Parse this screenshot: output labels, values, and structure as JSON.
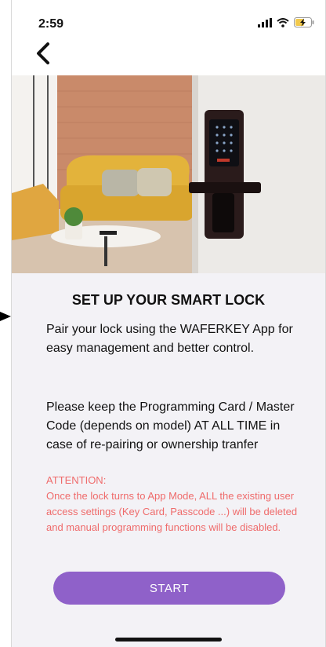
{
  "status": {
    "time": "2:59"
  },
  "content": {
    "title": "SET UP YOUR SMART LOCK",
    "paragraph1": "Pair your lock using the WAFERKEY App for easy management and better control.",
    "paragraph2": "Please keep the Programming Card / Master Code (depends on model) AT ALL TIME in case of re-pairing or ownership tranfer",
    "attention_label": "ATTENTION:",
    "attention_text": "Once the lock turns to App Mode, ALL the existing user access settings (Key Card, Passcode ...) will be deleted and manual programming functions will be disabled."
  },
  "start_label": "START",
  "icons": {
    "back": "chevron-left-icon",
    "signal": "signal-icon",
    "wifi": "wifi-icon",
    "battery": "battery-charging-icon"
  },
  "colors": {
    "accent": "#8f61c9",
    "warning": "#ef6b6b",
    "background": "#f3f2f6"
  }
}
